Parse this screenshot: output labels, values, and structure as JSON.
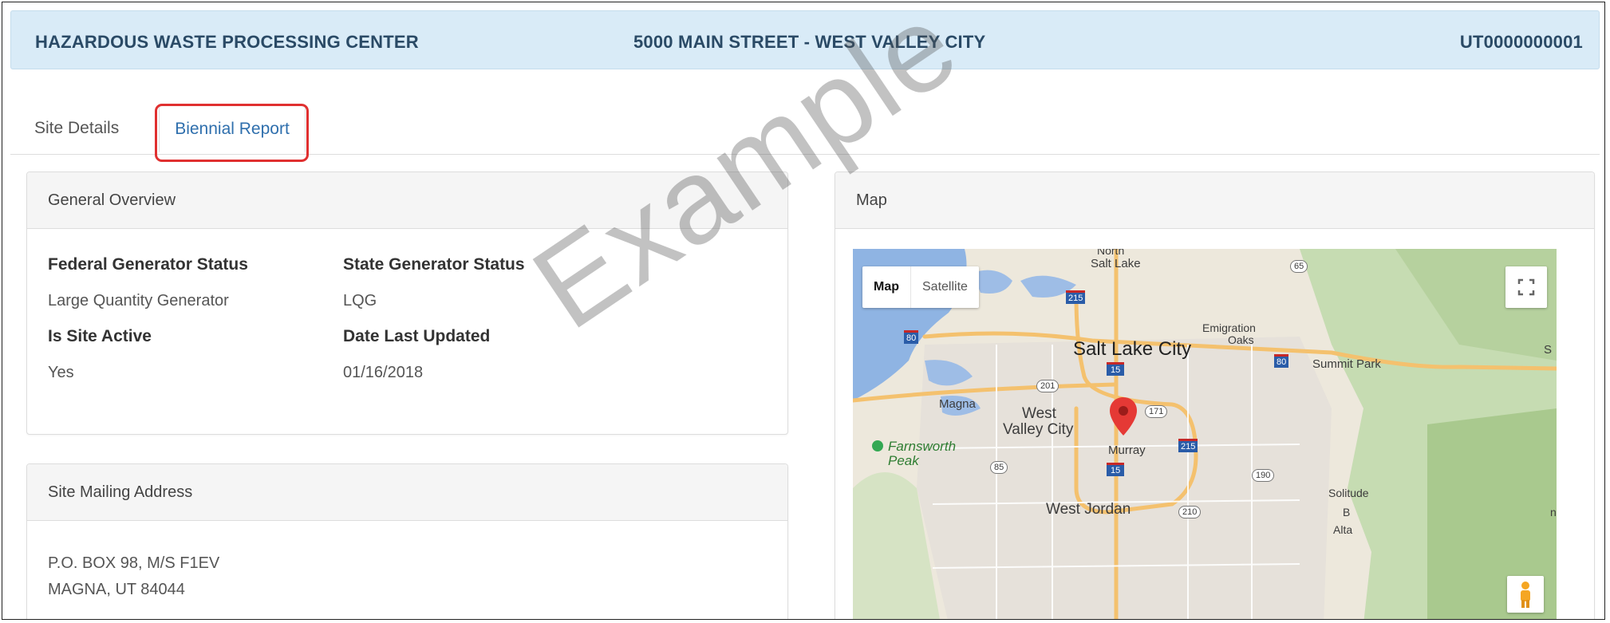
{
  "header": {
    "site_name": "HAZARDOUS WASTE PROCESSING CENTER",
    "address": "5000 MAIN STREET - WEST VALLEY CITY",
    "site_id": "UT0000000001"
  },
  "tabs": [
    {
      "label": "Site Details",
      "active": false
    },
    {
      "label": "Biennial Report",
      "active": true,
      "highlighted": true
    }
  ],
  "overview": {
    "title": "General Overview",
    "fields": [
      {
        "label": "Federal Generator Status",
        "value": "Large Quantity Generator"
      },
      {
        "label": "State Generator Status",
        "value": "LQG"
      },
      {
        "label": "Is Site Active",
        "value": "Yes"
      },
      {
        "label": "Date Last Updated",
        "value": "01/16/2018"
      }
    ]
  },
  "mailing": {
    "title": "Site Mailing Address",
    "line1": "P.O. BOX 98, M/S F1EV",
    "line2": "MAGNA, UT 84044"
  },
  "map_panel": {
    "title": "Map",
    "type_controls": [
      "Map",
      "Satellite"
    ],
    "labels": {
      "north": "North",
      "north_salt_lake": "Salt Lake",
      "salt_lake_city": "Salt Lake City",
      "emigration": "Emigration",
      "oaks": "Oaks",
      "summit_park": "Summit Park",
      "s": "S",
      "magna": "Magna",
      "west": "West",
      "valley_city": "Valley City",
      "farnsworth": "Farnsworth",
      "peak": "Peak",
      "murray": "Murray",
      "west_jordan": "West Jordan",
      "solitude": "Solitude",
      "b": "B",
      "n": "n",
      "alta": "Alta"
    },
    "shields": {
      "i80_w": "80",
      "i80_e": "80",
      "i215_n": "215",
      "i215_e": "215",
      "i15_n": "15",
      "i15_s": "15",
      "r65": "65",
      "r201": "201",
      "r171": "171",
      "r85": "85",
      "r190": "190",
      "r210": "210"
    }
  },
  "watermark": "Example",
  "colors": {
    "header_bg": "#d9ebf7",
    "header_text": "#2a4a66",
    "tab_active_text": "#2f6fad",
    "highlight_border": "#e03030",
    "marker": "#e53935"
  }
}
